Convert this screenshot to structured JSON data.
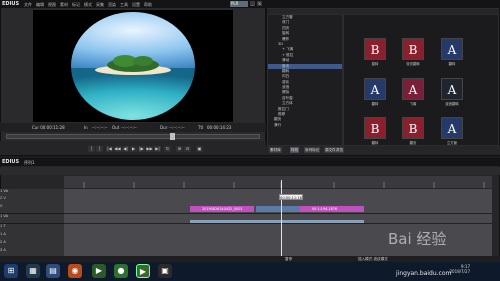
{
  "player": {
    "logo": "EDIUS",
    "menu": [
      "文件",
      "编辑",
      "视图",
      "素材",
      "标记",
      "模式",
      "采集",
      "渲染",
      "工具",
      "设置",
      "帮助"
    ],
    "plr": "PLR",
    "timecode": "Cur 00:00:11:28",
    "in_label": "In",
    "in_value": "--:--:--:--",
    "out_label": "Out",
    "out_value": "--:--:--:--",
    "dur_label": "Dur",
    "dur_value": "--:--:--:--",
    "ttl_label": "Ttl",
    "ttl_value": "00:00:14:23"
  },
  "right_panel": {
    "tree": [
      "立方管",
      "双门",
      "四页",
      "旋转",
      "爆炸",
      "3D",
      "+ 飞离",
      "+ 推拉",
      "滑动",
      "卷页",
      "翻转",
      "闪白",
      "溶化",
      "波浪",
      "擦除",
      "百叶窗",
      "立方体",
      "推拉门",
      "推移",
      "翻页",
      "滑行"
    ],
    "thumbs": [
      {
        "glyph": "B",
        "label": "旋转"
      },
      {
        "glyph": "B",
        "label": "双页翻转"
      },
      {
        "glyph": "A",
        "label": "翻转"
      },
      {
        "glyph": "A",
        "label": "翻转"
      },
      {
        "glyph": "A",
        "label": "飞离"
      },
      {
        "glyph": "A",
        "label": "波浪翻转"
      },
      {
        "glyph": "B",
        "label": "翻转"
      },
      {
        "glyph": "B",
        "label": "翻页"
      },
      {
        "glyph": "A",
        "label": "立方管"
      }
    ],
    "tabs": [
      "素材库",
      "特效",
      "序列标记",
      "源文件浏览"
    ]
  },
  "timeline": {
    "logo": "EDIUS",
    "sequence": "序列1",
    "track_labels": [
      "1 VA",
      "2 V",
      "V",
      "1 VA",
      "1 T",
      "1 A",
      "2 A",
      "3 A"
    ],
    "clip1": "20190826140432_0001",
    "clip3": "00:1:194-1876",
    "playhead_time": "00:00:11:16",
    "status_left": "暂停",
    "status_right": "插入模式   波纹模式"
  },
  "taskbar": {
    "time": "9:17",
    "date": "2019/7/27"
  },
  "watermark": "Bai 经验",
  "watermark_url": "jingyan.baidu.com"
}
